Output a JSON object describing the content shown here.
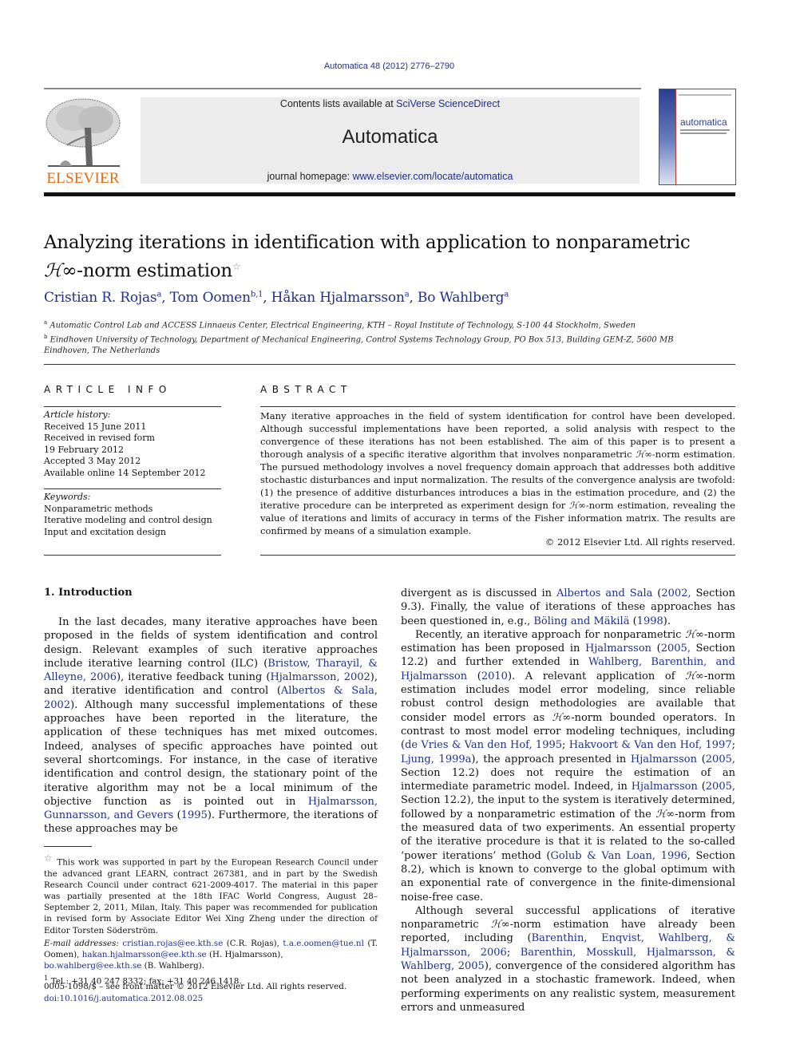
{
  "header": {
    "journal_ref": "Automatica 48 (2012) 2776–2790",
    "contents_prefix": "Contents lists available at ",
    "contents_link": "SciVerse ScienceDirect",
    "journal_title": "Automatica",
    "homepage_prefix": "journal homepage: ",
    "homepage_link": "www.elsevier.com/locate/automatica",
    "publisher_logo_text": "ELSEVIER",
    "cover_title": "automatica",
    "colors": {
      "link": "#1f2f8c",
      "elsevier_orange": "#e36b14",
      "banner_bg": "#ececec"
    }
  },
  "article": {
    "title_line1": "Analyzing iterations in identification with application to nonparametric",
    "title_hinf": "ℋ∞",
    "title_line2_rest": "-norm estimation",
    "title_footnote_mark": "☆",
    "authors": [
      {
        "name": "Cristian R. Rojas",
        "sup": "a"
      },
      {
        "name": "Tom Oomen",
        "sup": "b,1"
      },
      {
        "name": "Håkan Hjalmarsson",
        "sup": "a"
      },
      {
        "name": "Bo Wahlberg",
        "sup": "a"
      }
    ],
    "affiliations": [
      {
        "mark": "a",
        "text": "Automatic Control Lab and ACCESS Linnaeus Center, Electrical Engineering, KTH – Royal Institute of Technology, S-100 44 Stockholm, Sweden"
      },
      {
        "mark": "b",
        "text": "Eindhoven University of Technology, Department of Mechanical Engineering, Control Systems Technology Group, PO Box 513, Building GEM-Z, 5600 MB Eindhoven, The Netherlands"
      }
    ]
  },
  "article_info": {
    "heading": "ARTICLE INFO",
    "history_label": "Article history:",
    "history": [
      "Received 15 June 2011",
      "Received in revised form",
      "19 February 2012",
      "Accepted 3 May 2012",
      "Available online 14 September 2012"
    ],
    "keywords_label": "Keywords:",
    "keywords": [
      "Nonparametric methods",
      "Iterative modeling and control design",
      "Input and excitation design"
    ]
  },
  "abstract": {
    "heading": "ABSTRACT",
    "p1": "Many iterative approaches in the field of system identification for control have been developed. Although successful implementations have been reported, a solid analysis with respect to the convergence of these iterations has not been established. The aim of this paper is to present a thorough analysis of a specific iterative algorithm that involves nonparametric ",
    "hinf": "ℋ∞",
    "p2": "-norm estimation. The pursued methodology involves a novel frequency domain approach that addresses both additive stochastic disturbances and input normalization. The results of the convergence analysis are twofold: (1) the presence of additive disturbances introduces a bias in the estimation procedure, and (2) the iterative procedure can be interpreted as experiment design for ",
    "p3": "-norm estimation, revealing the value of iterations and limits of accuracy in terms of the Fisher information matrix. The results are confirmed by means of a simulation example.",
    "copyright": "© 2012 Elsevier Ltd. All rights reserved."
  },
  "intro": {
    "heading": "1.  Introduction",
    "left": {
      "t1": "In the last decades, many iterative approaches have been proposed in the fields of system identification and control design. Relevant examples of such iterative approaches include iterative learning control (ILC) (",
      "c1": "Bristow, Tharayil, & Alleyne, 2006",
      "t2": "), iterative feedback tuning (",
      "c2": "Hjalmarsson, 2002",
      "t3": "), and iterative identification and control (",
      "c3": "Albertos & Sala, 2002",
      "t4": "). Although many successful implementations of these approaches have been reported in the literature, the application of these techniques has met mixed outcomes. Indeed, analyses of specific approaches have pointed out several shortcomings. For instance, in the case of iterative identification and control design, the stationary point of the iterative algorithm may not be a local minimum of the objective function as is pointed out in ",
      "c4": "Hjalmarsson, Gunnarsson, and Gevers",
      "c4y": "1995",
      "t5": "). Furthermore, the iterations of these approaches may be"
    },
    "right": {
      "p1_t1": "divergent as is discussed in ",
      "p1_c1": "Albertos and Sala",
      "p1_c1y": "2002,",
      "p1_t2": " Section 9.3). Finally, the value of iterations of these approaches has been questioned in, e.g., ",
      "p1_c2": "Böling and Mäkilä",
      "p1_c2y": "1998",
      "p1_t3": ").",
      "p2_t1": "Recently, an iterative approach for nonparametric ",
      "hinf": "ℋ∞",
      "p2_t2": "-norm estimation has been proposed in ",
      "p2_c1": "Hjalmarsson",
      "p2_c1y": "2005,",
      "p2_t3": " Section 12.2) and further extended in ",
      "p2_c2": "Wahlberg, Barenthin, and Hjalmarsson",
      "p2_c2y": "2010",
      "p2_t4": "). A relevant application of ",
      "p2_t5": "-norm estimation includes model error modeling, since reliable robust control design methodologies are available that consider model errors as ",
      "p2_t6": "-norm bounded operators. In contrast to most model error modeling techniques, including (",
      "p2_c3": "de Vries & Van den Hof, 1995",
      "p2_c4": "Hakvoort & Van den Hof, 1997",
      "p2_c5": "Ljung, 1999a",
      "p2_t7": "), the approach presented in ",
      "p2_c6": "Hjalmarsson",
      "p2_c6y": "2005,",
      "p2_t8": " Section 12.2) does not require the estimation of an intermediate parametric model. Indeed, in ",
      "p2_c7": "Hjalmarsson",
      "p2_c7y": "2005,",
      "p2_t9": " Section 12.2), the input to the system is iteratively determined, followed by a nonparametric estimation of the ",
      "p2_t10": "-norm from the measured data of two experiments. An essential property of the iterative procedure is that it is related to the so-called ‘power iterations’ method (",
      "p2_c8": "Golub & Van Loan, 1996",
      "p2_t11": ", Section 8.2), which is known to converge to the global optimum with an exponential rate of convergence in the finite-dimensional noise-free case.",
      "p3_t1": "Although several successful applications of iterative nonparametric ",
      "p3_t2": "-norm estimation have already been reported, including (",
      "p3_c1": "Barenthin, Enqvist, Wahlberg, & Hjalmarsson, 2006",
      "p3_c2": "Barenthin, Mosskull, Hjalmarsson, & Wahlberg, 2005",
      "p3_t3": "), convergence of the considered algorithm has not been analyzed in a stochastic framework. Indeed, when performing experiments on any realistic system, measurement errors and unmeasured"
    }
  },
  "footnotes": {
    "star_mark": "☆",
    "star_text": "This work was supported in part by the European Research Council under the advanced grant LEARN, contract 267381, and in part by the Swedish Research Council under contract 621-2009-4017. The material in this paper was partially presented at the 18th IFAC World Congress, August 28–September 2, 2011, Milan, Italy. This paper was recommended for publication in revised form by Associate Editor Wei Xing Zheng under the direction of Editor Torsten Söderström.",
    "email_label": "E-mail addresses:",
    "emails": [
      {
        "email": "cristian.rojas@ee.kth.se",
        "name": "(C.R. Rojas)"
      },
      {
        "email": "t.a.e.oomen@tue.nl",
        "name": "(T. Oomen)"
      },
      {
        "email": "hakan.hjalmarsson@ee.kth.se",
        "name": "(H. Hjalmarsson)"
      },
      {
        "email": "bo.wahlberg@ee.kth.se",
        "name": "(B. Wahlberg)"
      }
    ],
    "one_mark": "1",
    "one_text": "Tel.: +31 40 247 8332; fax: +31 40 246 1418."
  },
  "footer": {
    "issn": "0005-1098/$ – see front matter © 2012 Elsevier Ltd. All rights reserved.",
    "doi": "doi:10.1016/j.automatica.2012.08.025"
  }
}
